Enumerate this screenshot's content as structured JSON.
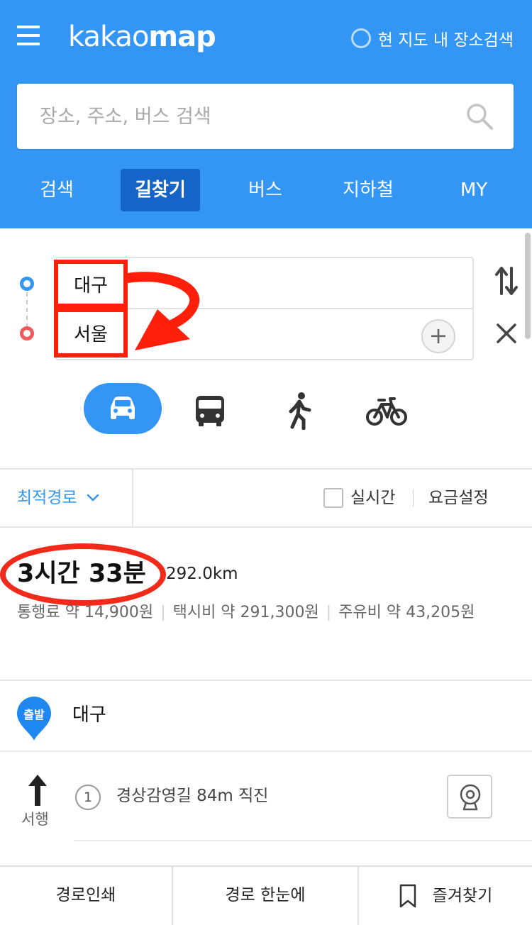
{
  "header": {
    "logo_light": "kakao",
    "logo_bold": "map",
    "local_search_label": "현 지도 내 장소검색",
    "search_placeholder": "장소, 주소, 버스 검색"
  },
  "tabs": [
    {
      "label": "검색",
      "active": false
    },
    {
      "label": "길찾기",
      "active": true
    },
    {
      "label": "버스",
      "active": false
    },
    {
      "label": "지하철",
      "active": false
    },
    {
      "label": "MY",
      "active": false
    }
  ],
  "route": {
    "origin": "대구",
    "destination": "서울",
    "add_label": "+"
  },
  "modes": [
    {
      "name": "car",
      "icon": "car-icon",
      "active": true
    },
    {
      "name": "transit",
      "icon": "bus-icon",
      "active": false
    },
    {
      "name": "walk",
      "icon": "walk-icon",
      "active": false
    },
    {
      "name": "bike",
      "icon": "bike-icon",
      "active": false
    }
  ],
  "options": {
    "route_type": "최적경로",
    "realtime_label": "실시간",
    "realtime_checked": false,
    "fee_setting_label": "요금설정"
  },
  "summary": {
    "duration": "3시간 33분",
    "distance": "292.0km",
    "toll": "통행료 약 14,900원",
    "taxi": "택시비 약 291,300원",
    "fuel": "주유비 약 43,205원"
  },
  "steps": {
    "start_badge": "출발",
    "start_place": "대구",
    "first_step_number": "1",
    "first_step_text": "경상감영길 84m 직진",
    "first_step_direction": "서행"
  },
  "bottom_bar": {
    "print": "경로인쇄",
    "overview": "경로 한눈에",
    "favorite": "즐겨찾기"
  },
  "colors": {
    "brand_blue": "#3396f4",
    "active_tab": "#1565c9",
    "annotation_red": "#ff1f0b",
    "origin_dot": "#3396f4",
    "dest_dot": "#f05a5a"
  }
}
